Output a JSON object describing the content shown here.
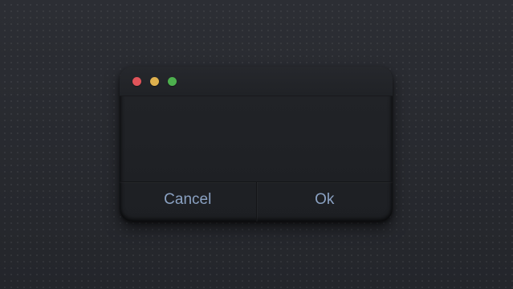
{
  "dialog": {
    "window_controls": [
      {
        "name": "close",
        "color": "#e0545a"
      },
      {
        "name": "minimize",
        "color": "#dfb14e"
      },
      {
        "name": "zoom",
        "color": "#4db04e"
      }
    ],
    "buttons": {
      "cancel_label": "Cancel",
      "ok_label": "Ok"
    },
    "accent_text_color": "#8aa1c2"
  }
}
